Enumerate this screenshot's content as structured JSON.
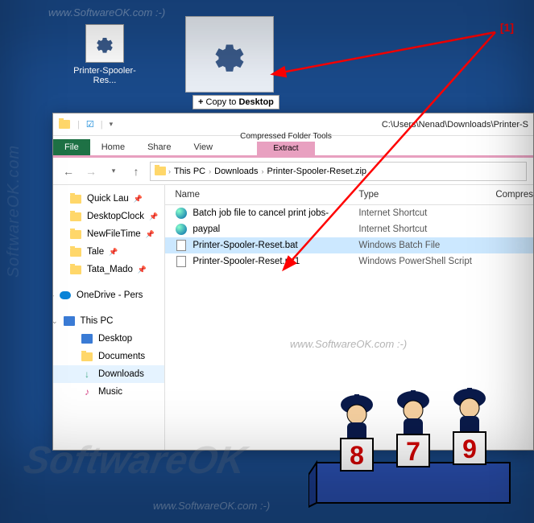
{
  "watermarks": {
    "text": "www.SoftwareOK.com  :-)",
    "brand_vert": "SoftwareOK.com"
  },
  "desktop": {
    "icon_label": "Printer-Spooler-Res..."
  },
  "tooltip": {
    "plus": "+",
    "action": "Copy to",
    "target": "Desktop"
  },
  "annotation": {
    "label": "[1]"
  },
  "explorer": {
    "title_path": "C:\\Users\\Nenad\\Downloads\\Printer-S",
    "ribbon": {
      "file": "File",
      "home": "Home",
      "share": "Share",
      "view": "View",
      "ctx_label": "Extract",
      "ctx_title": "Compressed Folder Tools"
    },
    "breadcrumb": {
      "root": "This PC",
      "p1": "Downloads",
      "p2": "Printer-Spooler-Reset.zip"
    },
    "nav": [
      {
        "label": "Quick Lau",
        "icon": "folder",
        "pin": true
      },
      {
        "label": "DesktopClock",
        "icon": "folder",
        "pin": true
      },
      {
        "label": "NewFileTime",
        "icon": "folder",
        "pin": true
      },
      {
        "label": "Tale",
        "icon": "folder",
        "pin": true
      },
      {
        "label": "Tata_Mado",
        "icon": "folder",
        "pin": true
      }
    ],
    "onedrive": "OneDrive - Pers",
    "thispc": "This PC",
    "pc_children": [
      {
        "label": "Desktop",
        "icon": "pc"
      },
      {
        "label": "Documents",
        "icon": "folder"
      },
      {
        "label": "Downloads",
        "icon": "down",
        "sel": true
      },
      {
        "label": "Music",
        "icon": "music"
      }
    ],
    "columns": {
      "name": "Name",
      "type": "Type",
      "comp": "Compres"
    },
    "files": [
      {
        "name": "Batch job file to cancel print jobs-",
        "type": "Internet Shortcut",
        "icon": "url"
      },
      {
        "name": "paypal",
        "type": "Internet Shortcut",
        "icon": "url"
      },
      {
        "name": "Printer-Spooler-Reset.bat",
        "type": "Windows Batch File",
        "icon": "file",
        "sel": true
      },
      {
        "name": "Printer-Spooler-Reset.ps1",
        "type": "Windows PowerShell Script",
        "icon": "file"
      }
    ]
  },
  "judges": {
    "scores": [
      "8",
      "7",
      "9"
    ]
  }
}
